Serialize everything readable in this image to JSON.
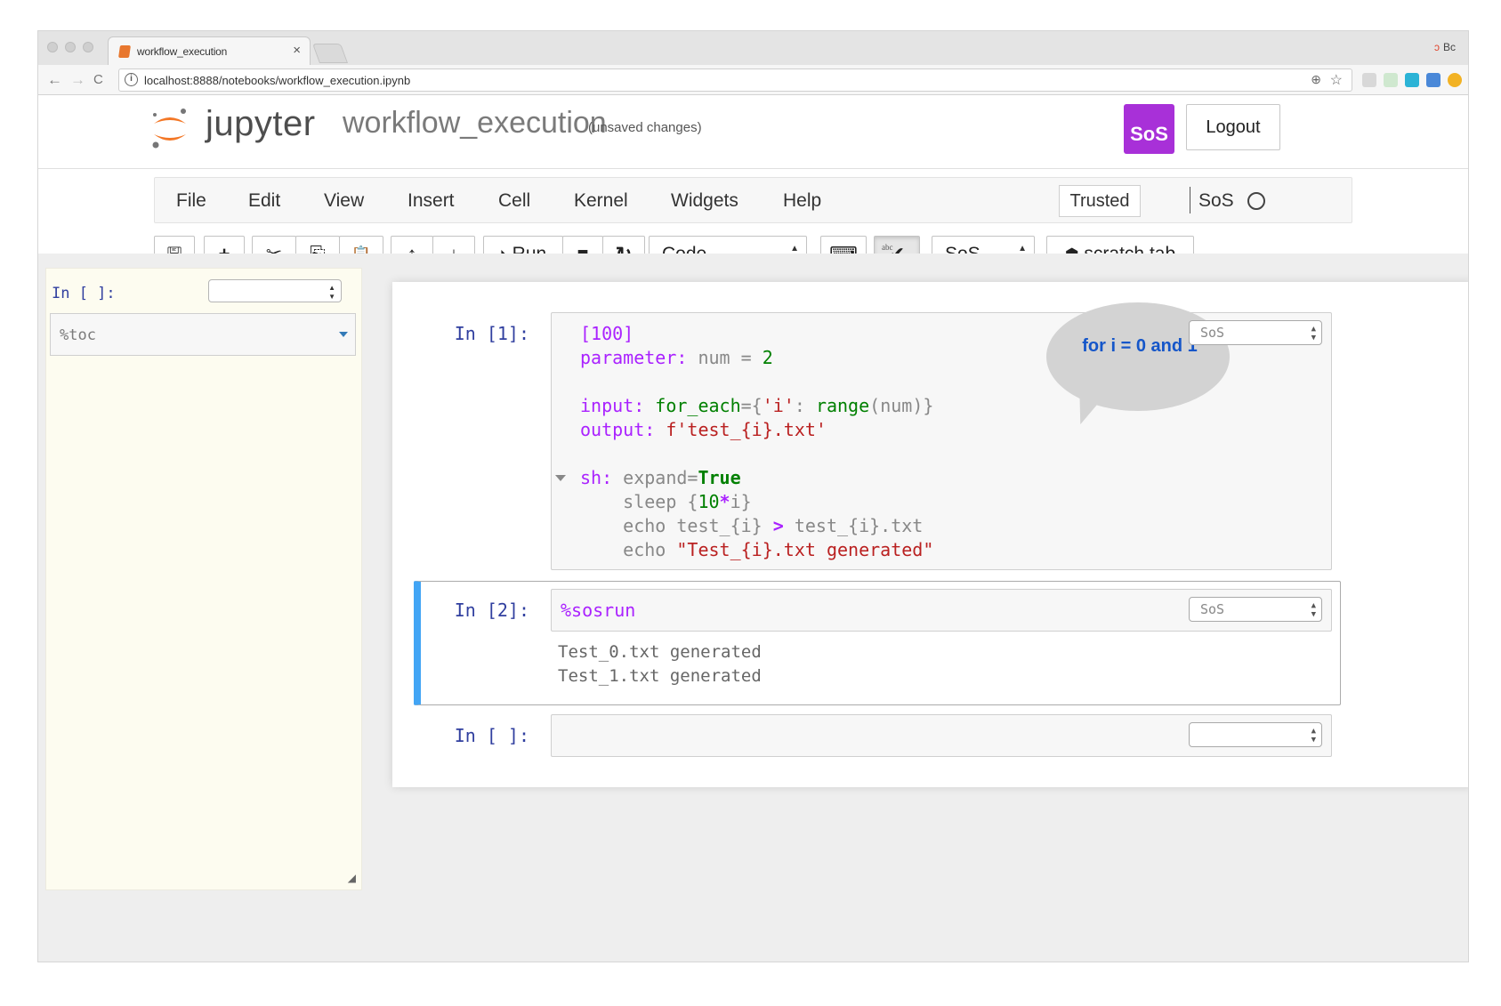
{
  "browser": {
    "tab_title": "workflow_execution",
    "tab_close": "×",
    "profile": "Bc",
    "url": "localhost:8888/notebooks/workflow_execution.ipynb",
    "back": "←",
    "forward": "→",
    "reload": "C",
    "info": "i",
    "zoom": "⊕",
    "star": "☆"
  },
  "header": {
    "logo_text": "jupyter",
    "notebook_name": "workflow_execution",
    "status": "(unsaved changes)",
    "sos_logo": "SoS",
    "logout": "Logout"
  },
  "menubar": {
    "items": [
      "File",
      "Edit",
      "View",
      "Insert",
      "Cell",
      "Kernel",
      "Widgets",
      "Help"
    ],
    "trusted": "Trusted",
    "kernel_name": "SoS"
  },
  "toolbar": {
    "save": "🖫",
    "insert": "+",
    "cut": "✂",
    "copy": "⎘",
    "paste": "📋",
    "move_up": "↑",
    "move_down": "↓",
    "run_label": "Run",
    "run_icon": "⏵",
    "stop": "■",
    "restart": "↻",
    "cell_type": "Code",
    "keyboard": "⌨",
    "spellcheck": "✔",
    "spellcheck_tag": "abc",
    "kernel_select": "SoS",
    "scratch_label": "scratch tab",
    "scratch_icon": "⬢"
  },
  "side_panel": {
    "prompt": "In [ ]:",
    "input": "%toc"
  },
  "cells": [
    {
      "prompt": "In [1]:",
      "kernel": "SoS",
      "lines": {
        "l1": "[100]",
        "l2a": "parameter:",
        "l2b": " num = ",
        "l2c": "2",
        "l4a": "input:",
        "l4b": " for_each",
        "l4c": "={",
        "l4d": "'i'",
        "l4e": ": ",
        "l4f": "range",
        "l4g": "(num)}",
        "l5a": "output:",
        "l5b": " f'test_{i}.txt'",
        "l7a": "sh:",
        "l7b": " expand=",
        "l7c": "True",
        "l8a": "    sleep {",
        "l8b": "10",
        "l8c": "*",
        "l8d": "i}",
        "l9a": "    echo test_{i} ",
        "l9b": ">",
        "l9c": " test_{i}.txt",
        "l10a": "    echo ",
        "l10b": "\"Test_{i}.txt generated\""
      },
      "callout": "for i = 0 and 1"
    },
    {
      "prompt": "In [2]:",
      "kernel": "SoS",
      "code": "%sosrun",
      "output": [
        "Test_0.txt generated",
        "Test_1.txt generated"
      ]
    },
    {
      "prompt": "In [ ]:",
      "kernel": ""
    }
  ],
  "colors": {
    "sos_purple": "#a830d8",
    "prompt_blue": "#303f9f",
    "selected_bar": "#42a5f5",
    "callout_text": "#1556c9"
  }
}
